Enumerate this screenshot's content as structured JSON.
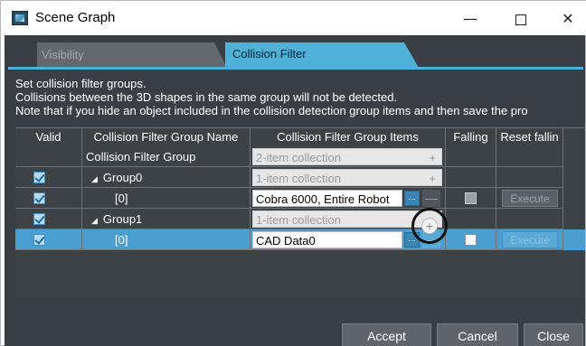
{
  "window": {
    "title": "Scene Graph",
    "minimize": "—",
    "close": "✕"
  },
  "tabs": [
    {
      "label": "Visibility",
      "active": false
    },
    {
      "label": "Collision Filter",
      "active": true
    }
  ],
  "description": [
    "Set collision filter groups.",
    "Collisions between the 3D shapes in the same group will not be detected.",
    "Note that if you hide an object included in the collision detection group items and then save the pro"
  ],
  "grid": {
    "columns": [
      "Valid",
      "Collision Filter Group Name",
      "Collision Filter Group Items",
      "Falling",
      "Reset fallin"
    ],
    "rows": [
      {
        "valid": null,
        "name": "Collision Filter Group",
        "items": "2-item collection",
        "items_kind": "collection",
        "falling": null,
        "reset": null
      },
      {
        "valid": true,
        "expander": "◢",
        "name": "Group0",
        "items": "1-item collection",
        "items_kind": "collection",
        "falling": null,
        "reset": null
      },
      {
        "valid": true,
        "name": "[0]",
        "items": "Cobra 6000, Entire Robot",
        "items_kind": "text",
        "falling": false,
        "reset": "Execute"
      },
      {
        "valid": true,
        "expander": "◢",
        "name": "Group1",
        "items": "1-item collection",
        "items_kind": "collection",
        "falling": null,
        "reset": null
      },
      {
        "valid": true,
        "name": "[0]",
        "items": "CAD Data0",
        "items_kind": "text",
        "falling": false,
        "reset": "Execute",
        "selected": true
      }
    ],
    "plus_symbol": "+",
    "minus_symbol": "—",
    "ellipsis": "..."
  },
  "buttons": {
    "accept": "Accept",
    "cancel": "Cancel",
    "close": "Close"
  },
  "colors": {
    "accent": "#4fb0d8",
    "panel": "#3a3f45",
    "selection": "#4a9fd0"
  }
}
